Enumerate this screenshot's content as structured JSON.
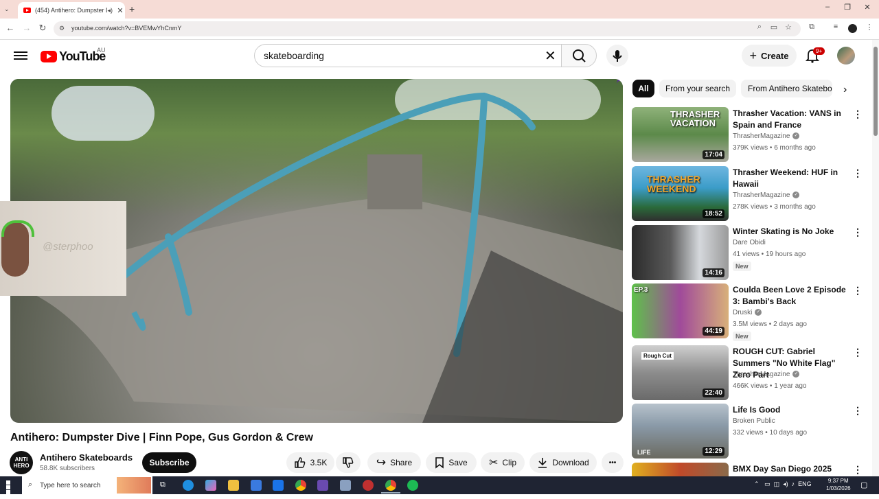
{
  "browser": {
    "tab_title": "(454) Antihero: Dumpster D",
    "url": "youtube.com/watch?v=BVEMwYhCnmY",
    "new_tab": "+",
    "close_tab": "✕",
    "minimize": "–",
    "maximize": "❐",
    "close": "✕"
  },
  "header": {
    "logo_text": "YouTube",
    "region": "AU",
    "search_value": "skateboarding",
    "create_label": "Create",
    "notifications_badge": "9+"
  },
  "video": {
    "title": "Antihero: Dumpster Dive | Finn Pope, Gus Gordon & Crew",
    "webcam_sign": "@sterphoo",
    "channel_avatar_text": "ANTI HERO",
    "channel_name": "Antihero Skateboards",
    "subscribers": "58.8K subscribers",
    "subscribe_label": "Subscribe",
    "likes": "3.5K",
    "share_label": "Share",
    "save_label": "Save",
    "clip_label": "Clip",
    "download_label": "Download",
    "more_label": "•••"
  },
  "chips": [
    "All",
    "From your search",
    "From Antihero Skateboards"
  ],
  "related": [
    {
      "title": "Thrasher Vacation: VANS in Spain and France",
      "channel": "ThrasherMagazine",
      "verified": true,
      "meta": "379K views • 6 months ago",
      "duration": "17:04",
      "thumb_text": "THRASHER VACATION",
      "new": ""
    },
    {
      "title": "Thrasher Weekend: HUF in Hawaii",
      "channel": "ThrasherMagazine",
      "verified": true,
      "meta": "278K views • 3 months ago",
      "duration": "18:52",
      "thumb_text": "THRASHER WEEKEND",
      "new": ""
    },
    {
      "title": "Winter Skating is No Joke",
      "channel": "Dare Obidi",
      "verified": false,
      "meta": "41 views • 19 hours ago",
      "duration": "14:16",
      "thumb_text": "",
      "new": "New"
    },
    {
      "title": "Coulda Been Love 2 Episode 3: Bambi's Back",
      "channel": "Druski",
      "verified": true,
      "meta": "3.5M views • 2 days ago",
      "duration": "44:19",
      "thumb_text": "EP.3",
      "new": "New"
    },
    {
      "title": "ROUGH CUT: Gabriel Summers \"No White Flag\" Zero Part",
      "channel": "ThrasherMagazine",
      "verified": true,
      "meta": "466K views • 1 year ago",
      "duration": "22:40",
      "thumb_text": "Rough Cut",
      "new": ""
    },
    {
      "title": "Life Is Good",
      "channel": "Broken Public",
      "verified": false,
      "meta": "332 views • 10 days ago",
      "duration": "12:29",
      "thumb_text": "LIFE",
      "new": ""
    },
    {
      "title": "BMX Day San Diego 2025",
      "channel": "",
      "verified": false,
      "meta": "",
      "duration": "",
      "thumb_text": "",
      "new": ""
    }
  ],
  "taskbar": {
    "search_placeholder": "Type here to search",
    "lang": "ENG",
    "time": "9:37 PM",
    "date": "1/03/2026"
  },
  "colors": {
    "youtube_red": "#ff0000",
    "tab_strip": "#f6dcd6",
    "taskbar": "#1f2433"
  }
}
